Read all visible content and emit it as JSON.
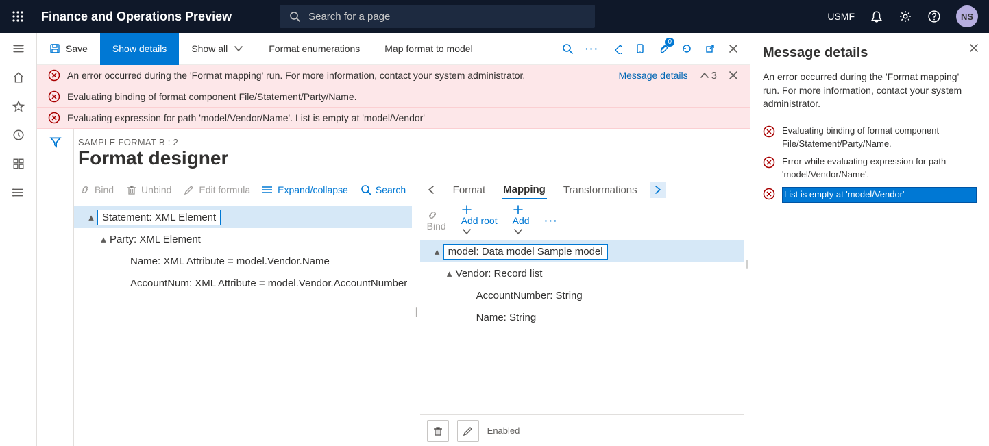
{
  "nav": {
    "app_title": "Finance and Operations Preview",
    "search_placeholder": "Search for a page",
    "legal_entity": "USMF",
    "avatar_initials": "NS"
  },
  "cmd": {
    "save": "Save",
    "show_details": "Show details",
    "show_all": "Show all",
    "format_enum": "Format enumerations",
    "map_format": "Map format to model"
  },
  "banners": {
    "line1": "An error occurred during the 'Format mapping' run. For more information, contact your system administrator.",
    "line2": "Evaluating binding of format component File/Statement/Party/Name.",
    "line3": "Evaluating expression for path 'model/Vendor/Name'.   List is empty at 'model/Vendor'",
    "details_link": "Message details",
    "error_count": "3"
  },
  "designer": {
    "crumb": "SAMPLE FORMAT B : 2",
    "title": "Format designer",
    "left_toolbar": {
      "bind": "Bind",
      "unbind": "Unbind",
      "edit": "Edit formula",
      "expand": "Expand/collapse",
      "search": "Search"
    },
    "tabs": {
      "format": "Format",
      "mapping": "Mapping",
      "transform": "Transformations"
    },
    "left_tree": {
      "n1": "Statement: XML Element",
      "n2": "Party: XML Element",
      "n3": "Name: XML Attribute = model.Vendor.Name",
      "n4": "AccountNum: XML Attribute = model.Vendor.AccountNumber"
    },
    "right_toolbar": {
      "bind": "Bind",
      "add_root": "Add root",
      "add": "Add"
    },
    "right_tree": {
      "n1": "model: Data model Sample model",
      "n2": "Vendor: Record list",
      "n3": "AccountNumber: String",
      "n4": "Name: String"
    },
    "prop": {
      "enabled": "Enabled"
    }
  },
  "sidepanel": {
    "title": "Message details",
    "desc": "An error occurred during the 'Format mapping' run. For more information, contact your system administrator.",
    "m1": "Evaluating binding of format component File/Statement/Party/Name.",
    "m2": "Error while evaluating expression for path 'model/Vendor/Name'.",
    "m3": "List is empty at 'model/Vendor'"
  }
}
